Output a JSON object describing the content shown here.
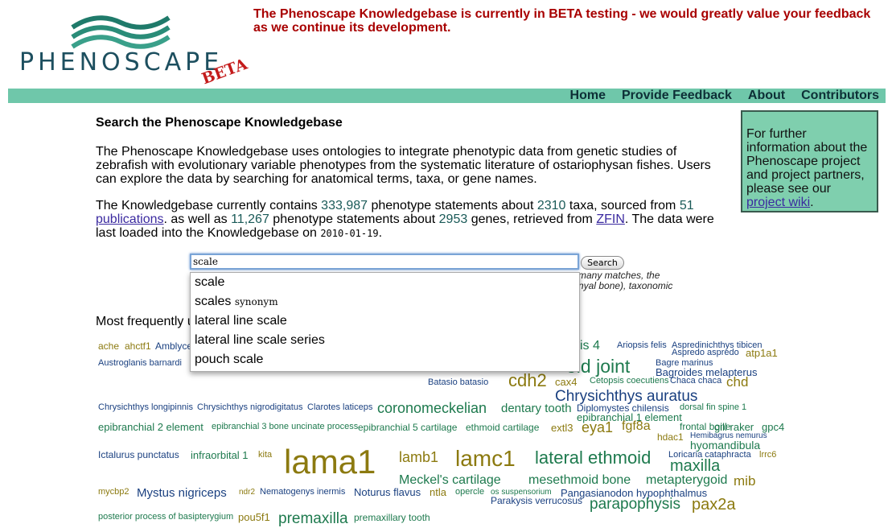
{
  "logo": {
    "text": "PHENOSCAPE",
    "badge": "BETA"
  },
  "banner": "The Phenoscape Knowledgebase is currently in BETA testing - we would greatly value your feedback as we continue its development.",
  "nav": [
    "Home",
    "Provide Feedback",
    "About",
    "Contributors"
  ],
  "sidebox": {
    "text": "For further information about the Phenoscape project and project partners, please see our ",
    "link": "project wiki",
    "end": "."
  },
  "main": {
    "title": "Search the Phenoscape Knowledgebase",
    "intro": "The Phenoscape Knowledgebase uses ontologies to integrate phenotypic data from genetic studies of zebrafish with evolutionary variable phenotypes from the systematic literature of ostariophysan fishes. Users can explore the data by searching for anatomical terms, taxa, or gene names.",
    "stats": {
      "t1": "The Knowledgebase currently contains ",
      "n1": "333,987",
      "t2": " phenotype statements about ",
      "n2": "2310",
      "t3": " taxa, sourced from ",
      "n3": "51",
      "l1": "publications",
      "t4": ". as well as ",
      "n4": "11,267",
      "t5": " phenotype statements about ",
      "n5": "2953",
      "t6": " genes, retrieved from ",
      "l2": "ZFIN",
      "t7": ". The data were last loaded into the Knowledgebase on ",
      "date": "2010-01-19",
      "t8": "."
    }
  },
  "search": {
    "value": "scale",
    "button": "Search",
    "hint_line1": "many matches, the",
    "hint_line2": "nyal bone), taxonomic"
  },
  "autocomplete": [
    {
      "label": "scale",
      "note": ""
    },
    {
      "label": "scales",
      "note": "synonym"
    },
    {
      "label": "lateral line scale",
      "note": ""
    },
    {
      "label": "lateral line scale series",
      "note": ""
    },
    {
      "label": "pouch scale",
      "note": ""
    }
  ],
  "frequent_label": "Most frequently u",
  "tag_cloud": [
    "ache",
    "ahctf1",
    "Amblyce",
    "Austroglanis barnardi",
    "ysis 4",
    "Ariopsis felis",
    "Aspredinichthys tibicen",
    "Aspredo aspredo",
    "atp1a1",
    "oid joint",
    "Bagre marinus",
    "Bagroides melapterus",
    "Batasio batasio",
    "cdh2",
    "cax4",
    "Cetopsis coecutiens",
    "Chaca chaca",
    "chd",
    "Chrysichthys auratus",
    "Chrysichthys longipinnis",
    "Chrysichthys nigrodigitatus",
    "Clarotes laticeps",
    "coronomeckelian",
    "dentary tooth",
    "Diplomystes chilensis",
    "dorsal fin spine 1",
    "epibranchial 1 element",
    "epibranchial 2 element",
    "epibranchial 3 bone uncinate process",
    "epibranchial 5 cartilage",
    "ethmoid cartilage",
    "extl3",
    "eya1",
    "fgf8a",
    "frontal bone",
    "gill raker",
    "gpc4",
    "hdac1",
    "Hemibagrus nemurus",
    "hyomandibula",
    "Ictalurus punctatus",
    "infraorbital 1",
    "kita",
    "lama1",
    "lamb1",
    "lamc1",
    "lateral ethmoid",
    "Loricaria cataphracta",
    "lrrc6",
    "maxilla",
    "Meckel's cartilage",
    "mesethmoid bone",
    "metapterygoid",
    "mib",
    "mycbp2",
    "Mystus nigriceps",
    "ndr2",
    "Nematogenys inermis",
    "Noturus flavus",
    "ntla",
    "opercle",
    "os suspensorium",
    "Pangasianodon hypophthalmus",
    "Parakysis verrucosus",
    "parapophysis",
    "pax2a",
    "posterior process of basipterygium",
    "pou5f1",
    "premaxilla",
    "premaxillary tooth"
  ]
}
